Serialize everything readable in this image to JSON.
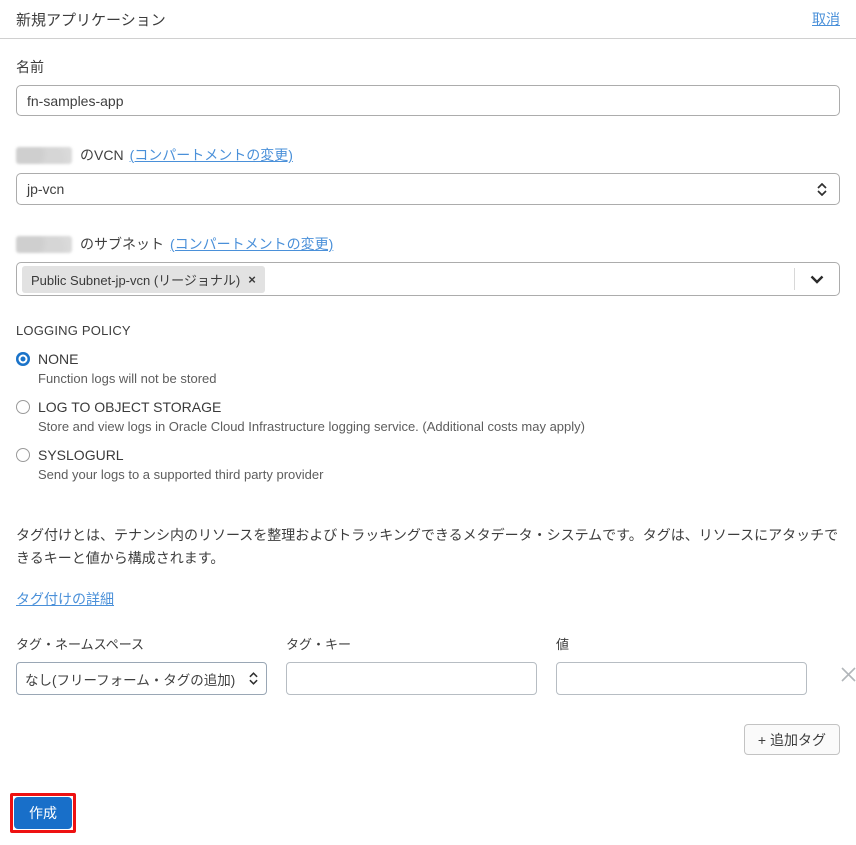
{
  "header": {
    "title": "新規アプリケーション",
    "cancel_label": "取消"
  },
  "name_field": {
    "label": "名前",
    "value": "fn-samples-app"
  },
  "vcn_field": {
    "label_suffix": "のVCN",
    "change_link": "(コンパートメントの変更)",
    "selected_value": "jp-vcn"
  },
  "subnet_field": {
    "label_suffix": "のサブネット",
    "change_link": "(コンパートメントの変更)",
    "chip_label": "Public Subnet-jp-vcn (リージョナル)",
    "chip_remove": "×"
  },
  "logging": {
    "title": "LOGGING POLICY",
    "options": [
      {
        "label": "NONE",
        "description": "Function logs will not be stored",
        "selected": true
      },
      {
        "label": "LOG TO OBJECT STORAGE",
        "description": "Store and view logs in Oracle Cloud Infrastructure logging service. (Additional costs may apply)",
        "selected": false
      },
      {
        "label": "SYSLOGURL",
        "description": "Send your logs to a supported third party provider",
        "selected": false
      }
    ]
  },
  "tagging": {
    "description": "タグ付けとは、テナンシ内のリソースを整理およびトラッキングできるメタデータ・システムです。タグは、リソースにアタッチできるキーと値から構成されます。",
    "details_link": "タグ付けの詳細",
    "namespace": {
      "label": "タグ・ネームスペース",
      "selected_value": "なし(フリーフォーム・タグの追加)"
    },
    "key": {
      "label": "タグ・キー",
      "value": ""
    },
    "value": {
      "label": "値",
      "value": ""
    },
    "add_tag_label": "+ 追加タグ"
  },
  "footer": {
    "create_label": "作成"
  },
  "colors": {
    "link": "#4a90d9",
    "primary": "#186fc9",
    "radio": "#1a73c9",
    "highlight": "#ee1111"
  }
}
